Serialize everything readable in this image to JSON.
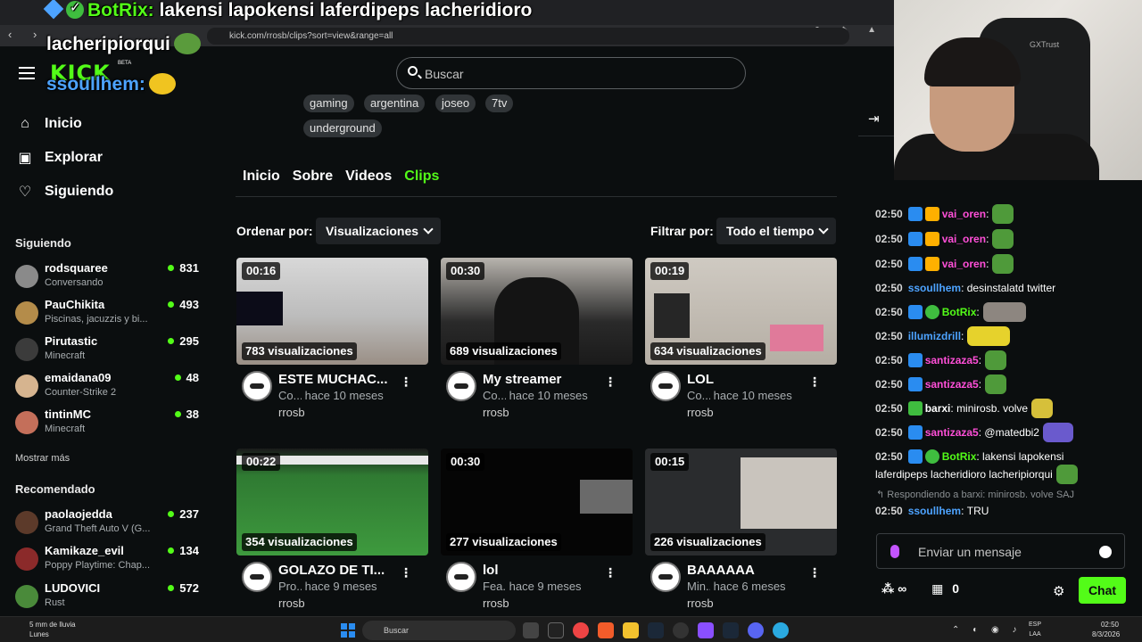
{
  "browser": {
    "url": "kick.com/rrosb/clips?sort=view&range=all"
  },
  "overlay": {
    "line1_user": "BotRix:",
    "line1_text": "lakensi lapokensi laferdipeps lacheridioro",
    "line2_text": "lacheripiorqui",
    "line3_user": "ssoullhem:"
  },
  "sidebar": {
    "logo": "KICK",
    "logo_beta": "BETA",
    "nav": [
      {
        "label": "Inicio",
        "icon": "home-icon"
      },
      {
        "label": "Explorar",
        "icon": "explore-icon"
      },
      {
        "label": "Siguiendo",
        "icon": "heart-icon"
      }
    ],
    "following_title": "Siguiendo",
    "following": [
      {
        "name": "rodsquaree",
        "sub": "Conversando",
        "viewers": "831"
      },
      {
        "name": "PauChikita",
        "sub": "Piscinas, jacuzzis y bi...",
        "viewers": "493"
      },
      {
        "name": "Pirutastic",
        "sub": "Minecraft",
        "viewers": "295"
      },
      {
        "name": "emaidana09",
        "sub": "Counter-Strike 2",
        "viewers": "48"
      },
      {
        "name": "tintinMC",
        "sub": "Minecraft",
        "viewers": "38"
      }
    ],
    "show_more": "Mostrar más",
    "recommended_title": "Recomendado",
    "recommended": [
      {
        "name": "paolaojedda",
        "sub": "Grand Theft Auto V (G...",
        "viewers": "237"
      },
      {
        "name": "Kamikaze_evil",
        "sub": "Poppy Playtime: Chap...",
        "viewers": "134"
      },
      {
        "name": "LUDOVICI",
        "sub": "Rust",
        "viewers": "572"
      }
    ]
  },
  "main": {
    "search_placeholder": "Buscar",
    "tags": [
      "gaming",
      "argentina",
      "joseo",
      "7tv",
      "underground"
    ],
    "tabs": [
      "Inicio",
      "Sobre",
      "Videos",
      "Clips"
    ],
    "active_tab": "Clips",
    "sort_label": "Ordenar por:",
    "sort_value": "Visualizaciones",
    "filter_label": "Filtrar por:",
    "filter_value": "Todo el tiempo",
    "clips": [
      {
        "duration": "00:16",
        "views": "783 visualizaciones",
        "title": "ESTE MUCHAC...",
        "category": "Co...",
        "age": "hace 10 meses",
        "author": "rrosb"
      },
      {
        "duration": "00:30",
        "views": "689 visualizaciones",
        "title": "My streamer",
        "category": "Co...",
        "age": "hace 10 meses",
        "author": "rrosb"
      },
      {
        "duration": "00:19",
        "views": "634 visualizaciones",
        "title": "LOL",
        "category": "Co...",
        "age": "hace 10 meses",
        "author": "rrosb"
      },
      {
        "duration": "00:22",
        "views": "354 visualizaciones",
        "title": "GOLAZO DE TI...",
        "category": "Pro...",
        "age": "hace 9 meses",
        "author": "rrosb"
      },
      {
        "duration": "00:30",
        "views": "277 visualizaciones",
        "title": "lol",
        "category": "Fea...",
        "age": "hace 9 meses",
        "author": "rrosb"
      },
      {
        "duration": "00:15",
        "views": "226 visualizaciones",
        "title": "BAAAAAA",
        "category": "Min...",
        "age": "hace 6 meses",
        "author": "rrosb"
      }
    ]
  },
  "chat": {
    "messages": [
      {
        "time": "02:50",
        "user": "vai_oren",
        "text": "",
        "color": "#ff4fd8"
      },
      {
        "time": "02:50",
        "user": "vai_oren",
        "text": "",
        "color": "#ff4fd8"
      },
      {
        "time": "02:50",
        "user": "vai_oren",
        "text": "",
        "color": "#ff4fd8"
      },
      {
        "time": "02:50",
        "user": "ssoullhem",
        "text": "desinstalatd twitter",
        "color": "#4da3ff"
      },
      {
        "time": "02:50",
        "user": "BotRix",
        "text": "",
        "color": "#53fc18"
      },
      {
        "time": "02:50",
        "user": "illumizdrill",
        "text": "",
        "color": "#4da3ff"
      },
      {
        "time": "02:50",
        "user": "santizaza5",
        "text": "",
        "color": "#ff4fd8"
      },
      {
        "time": "02:50",
        "user": "santizaza5",
        "text": "",
        "color": "#ff4fd8"
      },
      {
        "time": "02:50",
        "user": "barxi",
        "text": "minirosb. volve",
        "color": "#ffffff"
      },
      {
        "time": "02:50",
        "user": "santizaza5",
        "text": "@matedbi2",
        "color": "#ff4fd8"
      },
      {
        "time": "02:50",
        "user": "BotRix",
        "text": "lakensi lapokensi",
        "color": "#53fc18"
      }
    ],
    "wrap_line": "laferdipeps lacheridioro lacheripiorqui",
    "reply_note": "Respondiendo a barxi: minirosb. volve SAJ",
    "last_message": {
      "time": "02:50",
      "user": "ssoullhem",
      "text": "TRU",
      "color": "#4da3ff"
    },
    "input_placeholder": "Enviar un mensaje",
    "points": "0",
    "send_label": "Chat",
    "cam_brand": "GXTrust"
  },
  "taskbar": {
    "weather_line1": "5 mm de lluvia",
    "weather_line2": "Lunes",
    "search": "Buscar",
    "lang1": "ESP",
    "lang2": "LAA",
    "time": "02:50",
    "date": "8/3/2026"
  }
}
